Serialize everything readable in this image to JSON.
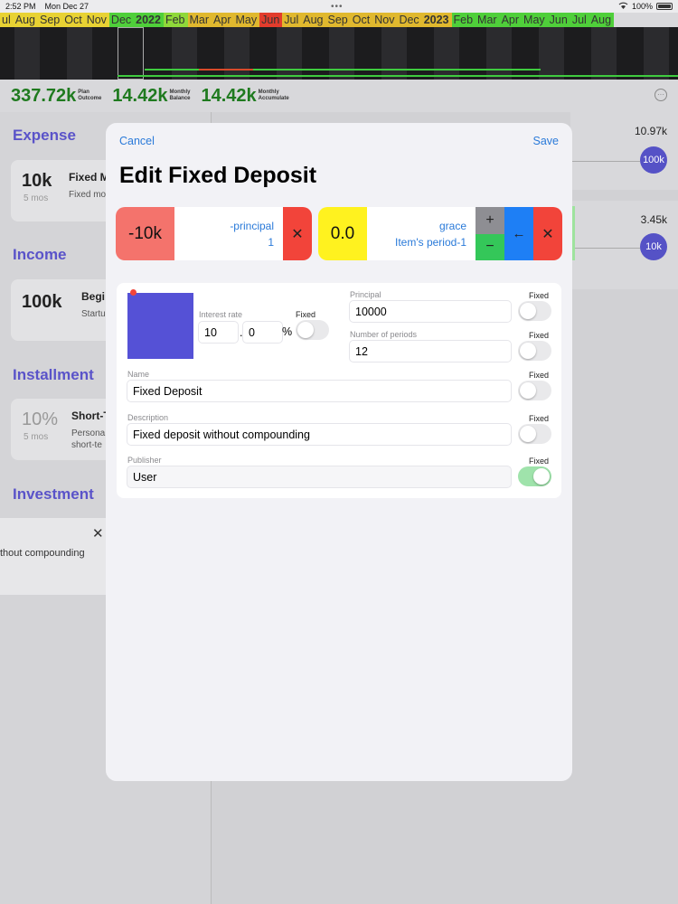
{
  "status": {
    "time": "2:52 PM",
    "date": "Mon Dec 27",
    "battery": "100%"
  },
  "timeline": {
    "months": [
      {
        "label": "ul",
        "color": "#e8d233"
      },
      {
        "label": "Aug",
        "color": "#e8d233"
      },
      {
        "label": "Sep",
        "color": "#e8d233"
      },
      {
        "label": "Oct",
        "color": "#e8d233"
      },
      {
        "label": "Nov",
        "color": "#e8d233"
      },
      {
        "label": "Dec",
        "color": "#4fcf3a"
      },
      {
        "label": "2022",
        "color": "#4fcf3a",
        "year": true
      },
      {
        "label": "Feb",
        "color": "#8fd83a"
      },
      {
        "label": "Mar",
        "color": "#e0b82e"
      },
      {
        "label": "Apr",
        "color": "#e0b82e"
      },
      {
        "label": "May",
        "color": "#e0b82e"
      },
      {
        "label": "Jun",
        "color": "#e23c2c"
      },
      {
        "label": "Jul",
        "color": "#e0b82e"
      },
      {
        "label": "Aug",
        "color": "#e0b82e"
      },
      {
        "label": "Sep",
        "color": "#e0b82e"
      },
      {
        "label": "Oct",
        "color": "#e0b82e"
      },
      {
        "label": "Nov",
        "color": "#e0b82e"
      },
      {
        "label": "Dec",
        "color": "#e0b82e"
      },
      {
        "label": "2023",
        "color": "#e0b82e",
        "year": true
      },
      {
        "label": "Feb",
        "color": "#4fcf3a"
      },
      {
        "label": "Mar",
        "color": "#4fcf3a"
      },
      {
        "label": "Apr",
        "color": "#4fcf3a"
      },
      {
        "label": "May",
        "color": "#4fcf3a"
      },
      {
        "label": "Jun",
        "color": "#4fcf3a"
      },
      {
        "label": "Jul",
        "color": "#4fcf3a"
      },
      {
        "label": "Aug",
        "color": "#4fcf3a"
      }
    ]
  },
  "summary": [
    {
      "value": "337.72k",
      "label1": "Plan",
      "label2": "Outcome"
    },
    {
      "value": "14.42k",
      "label1": "Monthly",
      "label2": "Balance"
    },
    {
      "value": "14.42k",
      "label1": "Monthly",
      "label2": "Accumulate"
    }
  ],
  "sidebar": {
    "expense": {
      "title": "Expense",
      "card": {
        "value": "10k",
        "duration": "5 mos",
        "title": "Fixed M",
        "subtitle": "Fixed mo"
      }
    },
    "income": {
      "title": "Income",
      "card": {
        "value": "100k",
        "title": "Begi",
        "subtitle": "Startu"
      }
    },
    "installment": {
      "title": "Installment",
      "card": {
        "value": "10%",
        "duration": "5 mos",
        "title": "Short-T",
        "subtitle1": "Persona",
        "subtitle2": "short-te"
      }
    },
    "investment": {
      "title": "Investment",
      "panel_text": "thout compounding"
    }
  },
  "right_list": [
    {
      "value": "10.97k",
      "badge": "100k"
    },
    {
      "value": "3.45k",
      "badge": "10k"
    }
  ],
  "modal": {
    "cancel": "Cancel",
    "save": "Save",
    "title": "Edit Fixed Deposit",
    "step1": {
      "value": "-10k",
      "label": "-principal",
      "count": "1",
      "value_color": "#f4736c"
    },
    "step2": {
      "value": "0.0",
      "label": "grace",
      "sublabel": "Item's period-1",
      "value_color": "#fff21f"
    },
    "form": {
      "color": "#5551d6",
      "interest_label": "Interest rate",
      "interest_int": "10",
      "interest_dot": ".",
      "interest_frac": "0",
      "percent": "%",
      "fixed_label": "Fixed",
      "principal_label": "Principal",
      "principal_value": "10000",
      "periods_label": "Number of periods",
      "periods_value": "12",
      "name_label": "Name",
      "name_value": "Fixed Deposit",
      "description_label": "Description",
      "description_value": "Fixed deposit without compounding",
      "publisher_label": "Publisher",
      "publisher_value": "User"
    }
  }
}
